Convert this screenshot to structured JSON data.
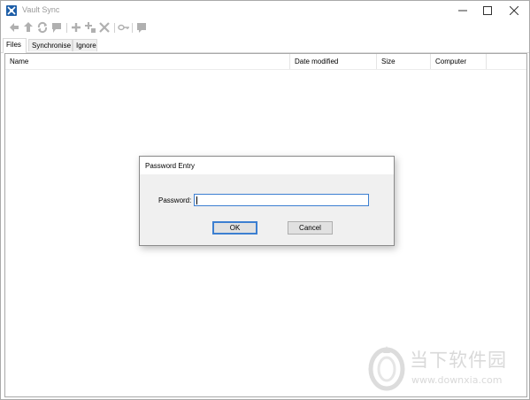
{
  "window": {
    "title": "Vault Sync",
    "icon": "vault-sync-app-icon",
    "controls": [
      "minimize-icon",
      "maximize-icon",
      "close-icon"
    ]
  },
  "toolbar": {
    "buttons": [
      {
        "icon": "back-arrow-icon",
        "enabled": false
      },
      {
        "icon": "up-arrow-icon",
        "enabled": false
      },
      {
        "icon": "refresh-icon",
        "enabled": false
      },
      {
        "icon": "flag-icon",
        "enabled": false
      },
      {
        "icon": "add-icon",
        "enabled": false
      },
      {
        "icon": "add-item-icon",
        "enabled": false
      },
      {
        "icon": "delete-icon",
        "enabled": false
      },
      {
        "icon": "key-icon",
        "enabled": false
      },
      {
        "icon": "comment-icon",
        "enabled": false
      }
    ]
  },
  "tabs": [
    {
      "label": "Files",
      "active": true
    },
    {
      "label": "Synchronise",
      "active": false
    },
    {
      "label": "Ignore",
      "active": false
    }
  ],
  "file_list": {
    "columns": [
      "Name",
      "Date modified",
      "Size",
      "Computer"
    ],
    "rows": []
  },
  "dialog": {
    "title": "Password Entry",
    "password_label": "Password:",
    "password_value": "",
    "ok_label": "OK",
    "cancel_label": "Cancel"
  },
  "watermark": {
    "text": "当下软件园",
    "url": "www.downxia.com"
  },
  "colors": {
    "accent": "#3c7fd1",
    "app_icon": "#1f5fa8",
    "disabled_icon": "#b0b0b0",
    "watermark": "#d9d9d9"
  }
}
